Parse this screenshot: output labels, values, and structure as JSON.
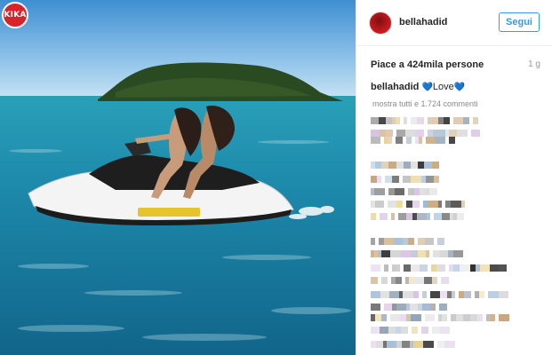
{
  "watermark": {
    "text": "KIKA"
  },
  "post": {
    "username": "bellahadid",
    "follow_label": "Segui",
    "likes_text": "Piace a 424mila persone",
    "time_ago": "1 g",
    "caption_user": "bellahadid",
    "caption_prefix": "💙",
    "caption_text": "Love",
    "caption_suffix": "💙",
    "show_comments": "mostra tutti e 1.724 commenti"
  },
  "colors": {
    "accent": "#3897f0",
    "watermark": "#d8232a",
    "avatar": "#b5161b",
    "heart": "#3d8fe6"
  },
  "icons": [
    "kika-logo-icon",
    "avatar-icon",
    "blue-heart-icon"
  ]
}
